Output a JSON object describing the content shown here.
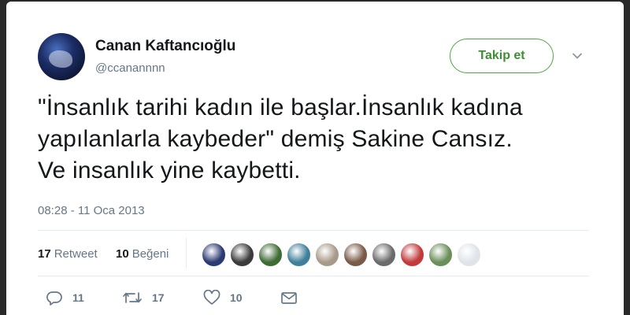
{
  "author": {
    "name": "Canan Kaftancıoğlu",
    "handle": "@ccanannnn"
  },
  "follow_label": "Takip et",
  "tweet": {
    "lines": [
      "\"İnsanlık tarihi kadın ile başlar.İnsanlık kadına",
      "yapılanlarla kaybeder\" demiş Sakine Cansız.",
      "Ve insanlık yine kaybetti."
    ],
    "timestamp": "08:28 - 11 Oca 2013"
  },
  "stats": {
    "retweet_count": "17",
    "retweet_label": "Retweet",
    "like_count": "10",
    "like_label": "Beğeni"
  },
  "likers": [
    {
      "color": "#2b3a73"
    },
    {
      "color": "#3b3b3b"
    },
    {
      "color": "#3f6b35"
    },
    {
      "color": "#3f7f9a"
    },
    {
      "color": "#a89a8a"
    },
    {
      "color": "#7a5a48"
    },
    {
      "color": "#6b6b6b"
    },
    {
      "color": "#c23a3a"
    },
    {
      "color": "#6a8f5a"
    },
    {
      "color": "#dfe4ea"
    }
  ],
  "actions": {
    "reply_count": "11",
    "retweet_count": "17",
    "like_count": "10"
  },
  "icons": {
    "chevron": "chevron-down-icon",
    "reply": "reply-icon",
    "retweet": "retweet-icon",
    "like": "heart-icon",
    "dm": "envelope-icon"
  },
  "colors": {
    "follow_green": "#3d8f33",
    "text_dark": "#14171a",
    "text_muted": "#657786"
  }
}
